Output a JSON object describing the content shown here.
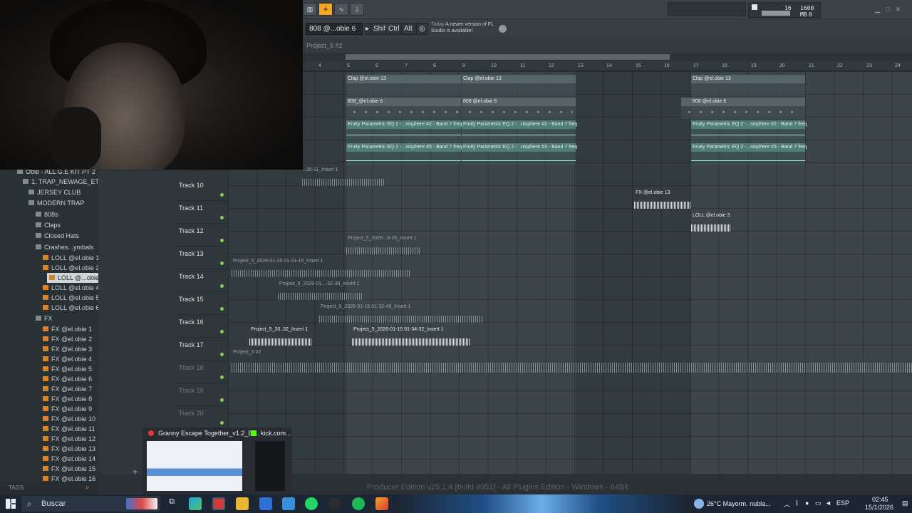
{
  "toolbar": {
    "tempo_display": "16",
    "memory": "1600 MB",
    "cpu_voices": "0",
    "channel_selector": "808 @...obie 6",
    "mod_keys": [
      "Shift",
      "Ctrl",
      "Alt"
    ],
    "news_today": "Today",
    "news_text": "A newer version of FL Studio is available!"
  },
  "playlist": {
    "title": "Project_5 #2",
    "bars": [
      "4",
      "5",
      "6",
      "7",
      "8",
      "9",
      "10",
      "11",
      "12",
      "13",
      "14",
      "15",
      "16",
      "17",
      "18",
      "19",
      "20",
      "21",
      "22",
      "23",
      "24"
    ],
    "tracks": [
      "Track 10",
      "Track 11",
      "Track 12",
      "Track 13",
      "Track 14",
      "Track 15",
      "Track 16",
      "Track 17",
      "Track 18",
      "Track 19",
      "Track 20"
    ],
    "clips": {
      "clap1": "Clap @el.obie 13",
      "clap2": "Clap @el.obie 13",
      "clap3": "Clap @el.obie 13",
      "b808_1": "808_@el.obie 6",
      "b808_2": "808 @el.obie 6",
      "b808_3": "808 @el.obie 6",
      "eq2_1": "Fruity Parametric EQ 2 - ..nisphere #2 - Band 7 freq",
      "eq2_2": "Fruity Parametric EQ 2 - ..nisphere #2 - Band 7 freq",
      "eq2_3": "Fruity Parametric EQ 2 - ..nisphere #2 - Band 7 freq",
      "eq3_1": "Fruity Parametric EQ 2 - ..nisphere #3 - Band 7 freq",
      "eq3_2": "Fruity Parametric EQ 2 - ..nisphere #3 - Band 7 freq",
      "eq3_3": "Fruity Parametric EQ 2 - ..nisphere #3 - Band 7 freq",
      "ins_top": "..26-11_Insert 1",
      "fx13": "FX @el.obie 13",
      "loll3": "LOLL @el.obie 3",
      "p_t12": "Project_5_2026-..6-26_Insert 1",
      "p_t13": "Project_5_2026-01-15 01-31-15_Insert 1",
      "p_t14": "Project_5_2026-01...-32-39_Insert 1",
      "p_t15": "Project_5_2026-01-15 01-32-46_Insert 1",
      "p_t16a": "Project_5_20..32_Insert 1",
      "p_t16b": "Project_5_2026-01-15 01-34-32_Insert 1",
      "p_t17": "Project_5 #2"
    }
  },
  "browser": {
    "items": [
      {
        "label": "Obie - ALL G.E KIT PT 2",
        "type": "folder"
      },
      {
        "label": "1. TRAP_NEWAGE_ETC",
        "type": "folder"
      },
      {
        "label": "JERSEY CLUB",
        "type": "folder"
      },
      {
        "label": "MODERN TRAP",
        "type": "folder"
      },
      {
        "label": "808s",
        "type": "folder"
      },
      {
        "label": "Claps",
        "type": "folder"
      },
      {
        "label": "Closed Hats",
        "type": "folder"
      },
      {
        "label": "Crashes...ymbals",
        "type": "folder"
      },
      {
        "label": "LOLL @el.obie 1",
        "type": "file"
      },
      {
        "label": "LOLL @el.obie 2",
        "type": "file"
      },
      {
        "label": "LOLL @...obie 3",
        "type": "file",
        "selected": true
      },
      {
        "label": "LOLL @el.obie 4",
        "type": "file"
      },
      {
        "label": "LOLL @el.obie 5",
        "type": "file"
      },
      {
        "label": "LOLL @el.obie 6",
        "type": "file"
      },
      {
        "label": "FX",
        "type": "folder"
      },
      {
        "label": "FX @el.obie 1",
        "type": "file"
      },
      {
        "label": "FX @el.obie 2",
        "type": "file"
      },
      {
        "label": "FX @el.obie 3",
        "type": "file"
      },
      {
        "label": "FX @el.obie 4",
        "type": "file"
      },
      {
        "label": "FX @el.obie 5",
        "type": "file"
      },
      {
        "label": "FX @el.obie 6",
        "type": "file"
      },
      {
        "label": "FX @el.obie 7",
        "type": "file"
      },
      {
        "label": "FX @el.obie 8",
        "type": "file"
      },
      {
        "label": "FX @el.obie 9",
        "type": "file"
      },
      {
        "label": "FX @el.obie 10",
        "type": "file"
      },
      {
        "label": "FX @el.obie 11",
        "type": "file"
      },
      {
        "label": "FX @el.obie 12",
        "type": "file"
      },
      {
        "label": "FX @el.obie 13",
        "type": "file"
      },
      {
        "label": "FX @el.obie 14",
        "type": "file"
      },
      {
        "label": "FX @el.obie 15",
        "type": "file"
      },
      {
        "label": "FX @el.obie 16",
        "type": "file"
      }
    ],
    "tags_label": "TAGS"
  },
  "status_bar": "Producer Edition v25.1.4 [build 4951] - All Plugins Edition - Windows - 64Bit",
  "taskbar_popup": {
    "window1": "Granny Escape Together_v1.2_El...",
    "window2": "kick.com..."
  },
  "taskbar": {
    "search_placeholder": "Buscar",
    "weather": "26°C  Mayorm. nubla...",
    "language": "ESP",
    "time": "02:45",
    "date": "15/1/2026"
  },
  "colors": {
    "accent": "#f5a524",
    "grid": "#3a4449",
    "automation": "#4f7d78",
    "led": "#8bd34a"
  }
}
